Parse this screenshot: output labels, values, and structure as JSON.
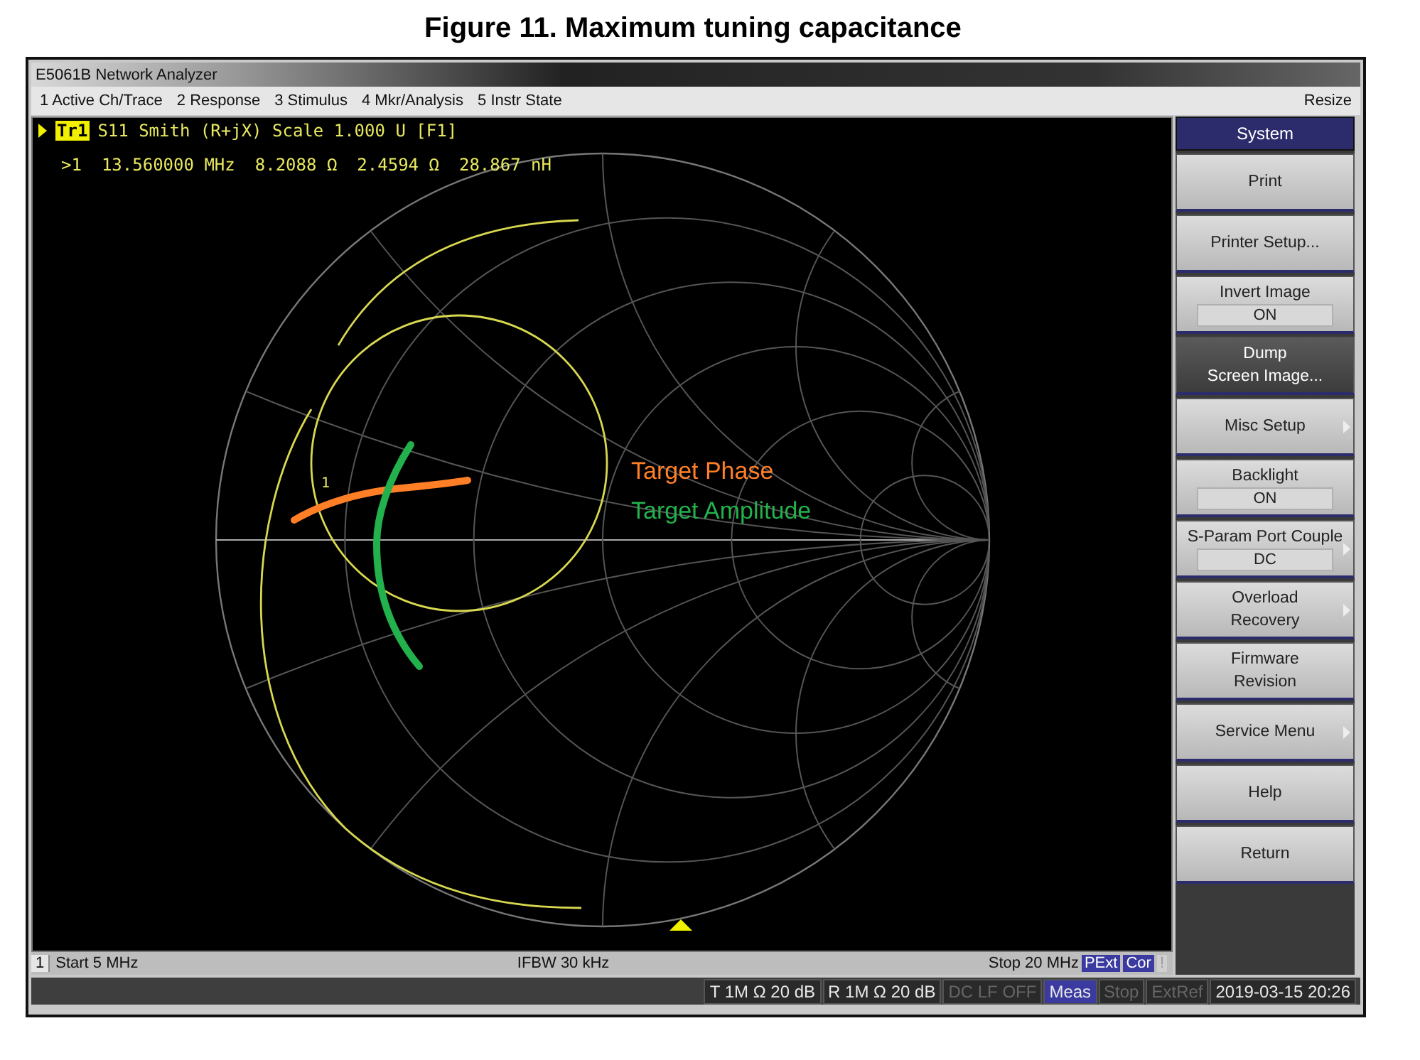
{
  "figure_caption": "Figure 11. Maximum tuning capacitance",
  "window": {
    "title": "E5061B Network Analyzer"
  },
  "menu": {
    "items": [
      "1 Active Ch/Trace",
      "2 Response",
      "3 Stimulus",
      "4 Mkr/Analysis",
      "5 Instr State"
    ],
    "resize": "Resize"
  },
  "trace": {
    "label": "Tr1",
    "active": true,
    "description": "S11 Smith (R+jX) Scale 1.000 U [F1]"
  },
  "marker_readout": {
    "marker": ">1",
    "values": [
      "13.560000 MHz",
      "8.2088 Ω",
      "2.4594 Ω",
      "28.867 nH"
    ]
  },
  "marker_label": "1",
  "annotations": [
    {
      "text": "Target Phase",
      "color": "#ff7f27"
    },
    {
      "text": "Target Amplitude",
      "color": "#22b14c"
    }
  ],
  "channel_status": {
    "channel": "1",
    "start": "Start 5 MHz",
    "ifbw": "IFBW 30 kHz",
    "stop": "Stop 20 MHz",
    "flags": [
      {
        "text": "PExt",
        "active": true
      },
      {
        "text": "Cor",
        "active": true
      },
      {
        "text": "!",
        "active": false
      }
    ]
  },
  "softkeys": {
    "title": "System",
    "keys": [
      {
        "label": "Print",
        "submenu": false,
        "highlighted": false
      },
      {
        "label": "Printer Setup...",
        "submenu": false,
        "highlighted": false
      },
      {
        "label": "Invert Image",
        "value": "ON",
        "submenu": false,
        "highlighted": false
      },
      {
        "label": "Dump\nScreen Image...",
        "submenu": false,
        "highlighted": true
      },
      {
        "label": "Misc Setup",
        "submenu": true,
        "highlighted": false
      },
      {
        "label": "Backlight",
        "value": "ON",
        "submenu": false,
        "highlighted": false
      },
      {
        "label": "S-Param Port Couple",
        "value": "DC",
        "submenu": true,
        "highlighted": false
      },
      {
        "label": "Overload\nRecovery",
        "submenu": true,
        "highlighted": false
      },
      {
        "label": "Firmware\nRevision",
        "submenu": false,
        "highlighted": false
      },
      {
        "label": "Service Menu",
        "submenu": true,
        "highlighted": false
      },
      {
        "label": "Help",
        "submenu": false,
        "highlighted": false
      },
      {
        "label": "Return",
        "submenu": false,
        "highlighted": false
      }
    ]
  },
  "status_bar": [
    {
      "text": "T 1M Ω 20 dB",
      "disabled": false,
      "highlighted": false
    },
    {
      "text": "R 1M Ω 20 dB",
      "disabled": false,
      "highlighted": false
    },
    {
      "text": "DC LF OFF",
      "disabled": true,
      "highlighted": false
    },
    {
      "text": "Meas",
      "disabled": false,
      "highlighted": true
    },
    {
      "text": "Stop",
      "disabled": true,
      "highlighted": false
    },
    {
      "text": "ExtRef",
      "disabled": true,
      "highlighted": false
    },
    {
      "text": "2019-03-15 20:26",
      "disabled": false,
      "highlighted": false
    }
  ]
}
